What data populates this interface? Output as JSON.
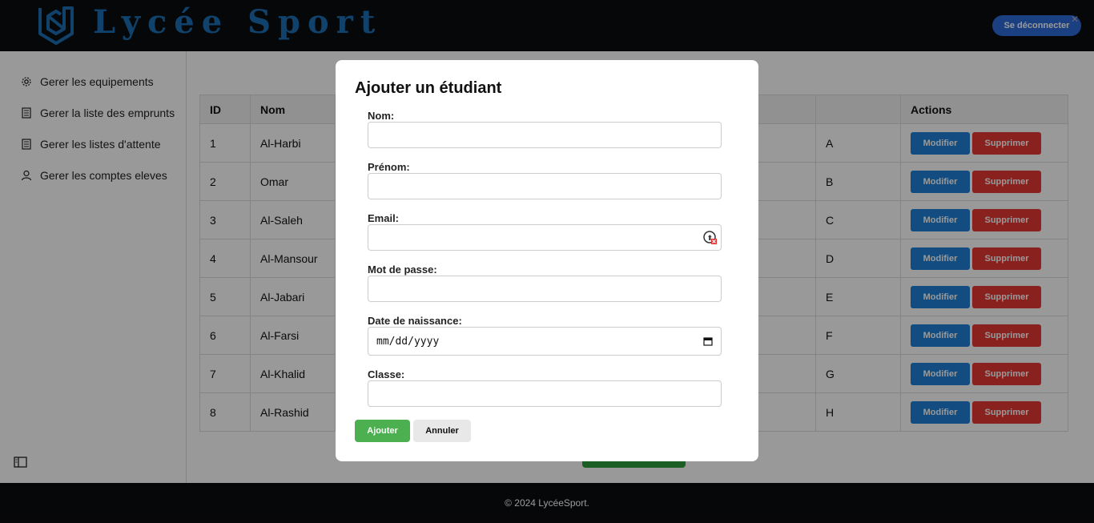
{
  "header": {
    "app_title": "Lycée Sport",
    "logout_label": "Se déconnecter",
    "logout_close": "✕"
  },
  "sidebar": {
    "items": [
      {
        "label": "Gerer les equipements",
        "icon": "gear-icon"
      },
      {
        "label": "Gerer la liste des emprunts",
        "icon": "list-icon"
      },
      {
        "label": "Gerer les listes d'attente",
        "icon": "list-icon"
      },
      {
        "label": "Gerer les comptes eleves",
        "icon": "user-icon"
      }
    ],
    "toggle_icon": "sidebar-toggle-icon"
  },
  "table": {
    "headers": [
      "ID",
      "Nom",
      "Actions"
    ],
    "rows": [
      {
        "id": "1",
        "nom": "Al-Harbi",
        "classe": "A"
      },
      {
        "id": "2",
        "nom": "Omar",
        "classe": "B"
      },
      {
        "id": "3",
        "nom": "Al-Saleh",
        "classe": "C"
      },
      {
        "id": "4",
        "nom": "Al-Mansour",
        "classe": "D"
      },
      {
        "id": "5",
        "nom": "Al-Jabari",
        "classe": "E"
      },
      {
        "id": "6",
        "nom": "Al-Farsi",
        "classe": "F"
      },
      {
        "id": "7",
        "nom": "Al-Khalid",
        "classe": "G"
      },
      {
        "id": "8",
        "nom": "Al-Rashid",
        "classe": "H"
      }
    ],
    "edit_label": "Modifier",
    "delete_label": "Supprimer"
  },
  "footer": {
    "text": "© 2024 LycéeSport."
  },
  "modal": {
    "title": "Ajouter un étudiant",
    "fields": {
      "nom": {
        "label": "Nom:",
        "value": ""
      },
      "prenom": {
        "label": "Prénom:",
        "value": ""
      },
      "email": {
        "label": "Email:",
        "value": ""
      },
      "password": {
        "label": "Mot de passe:",
        "value": ""
      },
      "birthdate": {
        "label": "Date de naissance:",
        "placeholder": "mm/dd/yyyy"
      },
      "classe": {
        "label": "Classe:",
        "value": ""
      }
    },
    "submit_label": "Ajouter",
    "cancel_label": "Annuler"
  },
  "colors": {
    "header_bg": "#0b0c10",
    "brand": "#1b6fb5",
    "edit": "#1f7fd6",
    "delete": "#e53935",
    "submit": "#4caf50"
  }
}
